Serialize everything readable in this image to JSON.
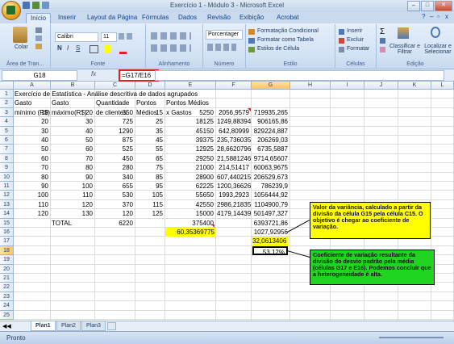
{
  "window": {
    "title": "Exercício 1 - Módulo 3 - Microsoft Excel"
  },
  "ribbon_tabs": [
    "Início",
    "Inserir",
    "Layout da Página",
    "Fórmulas",
    "Dados",
    "Revisão",
    "Exibição",
    "Acrobat"
  ],
  "ribbon": {
    "clipboard": {
      "paste": "Colar",
      "label": "Área de Tran..."
    },
    "font": {
      "name": "Calibri",
      "size": "11",
      "bold": "N",
      "italic": "I",
      "underline": "S",
      "label": "Fonte"
    },
    "alignment": {
      "label": "Alinhamento"
    },
    "number": {
      "format": "Porcentager",
      "label": "Número"
    },
    "styles": {
      "conditional": "Formatação Condicional",
      "table": "Formatar como Tabela",
      "cell": "Estilos de Célula",
      "label": "Estilo"
    },
    "cells": {
      "insert": "Inserir",
      "delete": "Excluir",
      "format": "Formatar",
      "label": "Células"
    },
    "editing": {
      "sort": "Classificar e Filtrar",
      "find": "Localizar e Selecionar",
      "label": "Edição"
    }
  },
  "formula_bar": {
    "name_box": "G18",
    "fx": "fx",
    "formula": "=G17/E16"
  },
  "columns": [
    "A",
    "B",
    "C",
    "D",
    "E",
    "F",
    "G",
    "H",
    "I",
    "J",
    "K",
    "L"
  ],
  "rows": [
    "1",
    "2",
    "3",
    "4",
    "5",
    "6",
    "7",
    "8",
    "9",
    "10",
    "11",
    "12",
    "13",
    "14",
    "15",
    "16",
    "17",
    "18",
    "19",
    "20",
    "21",
    "22",
    "23",
    "24",
    "25"
  ],
  "sheet": {
    "title": "Exercício de Estatística - Análise descritiva de dados agrupados",
    "headers": {
      "a": [
        "Gasto",
        "mínimo (R$)"
      ],
      "b": [
        "Gasto",
        "máximo(R$)"
      ],
      "c": [
        "Quantidade",
        "de clientes"
      ],
      "d": [
        "Pontos",
        "Médios"
      ],
      "e": [
        "Pontos Médios",
        "x Gastos"
      ]
    },
    "data": [
      [
        "10",
        "20",
        "350",
        "15",
        "5250",
        "2056,9579",
        "719935,265"
      ],
      [
        "20",
        "30",
        "725",
        "25",
        "18125",
        "1249,88394",
        "906165,86"
      ],
      [
        "30",
        "40",
        "1290",
        "35",
        "45150",
        "642,80999",
        "829224,887"
      ],
      [
        "40",
        "50",
        "875",
        "45",
        "39375",
        "235,736035",
        "206269,03"
      ],
      [
        "50",
        "60",
        "525",
        "55",
        "12925",
        "28,6620796",
        "6735,5887"
      ],
      [
        "60",
        "70",
        "450",
        "65",
        "29250",
        "21,5881246",
        "9714,65607"
      ],
      [
        "70",
        "80",
        "280",
        "75",
        "21000",
        "214,51417",
        "60063,9675"
      ],
      [
        "80",
        "90",
        "340",
        "85",
        "28900",
        "607,440215",
        "206529,673"
      ],
      [
        "90",
        "100",
        "655",
        "95",
        "62225",
        "1200,36626",
        "786239,9"
      ],
      [
        "100",
        "110",
        "530",
        "105",
        "55650",
        "1993,2923",
        "1056444,92"
      ],
      [
        "110",
        "120",
        "370",
        "115",
        "42550",
        "2986,21835",
        "1104900,79"
      ],
      [
        "120",
        "130",
        "120",
        "125",
        "15000",
        "4179,14439",
        "501497,327"
      ]
    ],
    "total": {
      "label": "TOTAL",
      "c": "6220",
      "e": "375400",
      "g": "6393721,86"
    },
    "row16": {
      "e": "60,35369775",
      "g": "1027,92956"
    },
    "row17": {
      "g": "32,0613406"
    },
    "row18": {
      "g": "53,12%"
    }
  },
  "notes": {
    "variance": "Valor da variância, calculado a partir da divisão da célula G15 pela célula C15. O objetivo é chegar ao coeficiente de variação.",
    "cv": "Coeficiente de variação resultante da divisão do desvio padrão pela média (células G17 e E16). Podemos concluir que a heterogeneidade é alta."
  },
  "sheet_tabs": [
    "Plan1",
    "Plan2",
    "Plan3"
  ],
  "status": {
    "text": "Pronto"
  },
  "colors": {
    "highlight": "#ffff00",
    "note_green": "#21d421",
    "formula_border": "#e02020"
  }
}
